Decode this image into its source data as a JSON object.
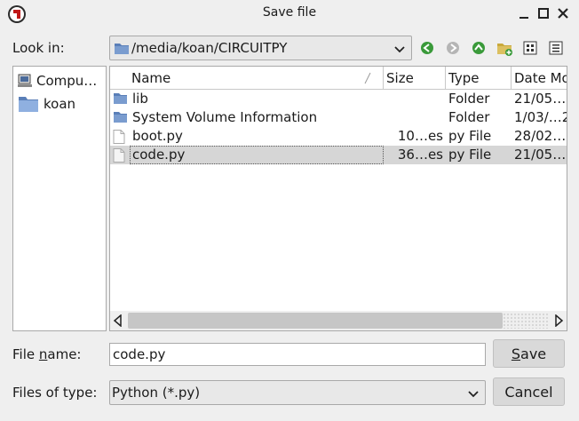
{
  "window": {
    "title": "Save file",
    "icons": {
      "app": "app-logo-icon",
      "minimize": "minimize-icon",
      "maximize": "maximize-icon",
      "close": "close-icon"
    }
  },
  "look_in": {
    "label": "Look in:",
    "path": "/media/koan/CIRCUITPY"
  },
  "toolbar": {
    "icons": [
      "back-icon",
      "forward-icon",
      "parent-dir-icon",
      "new-folder-icon",
      "list-view-icon",
      "detail-view-icon"
    ]
  },
  "sidebar": {
    "items": [
      {
        "label": "Compu…",
        "icon": "computer-icon"
      },
      {
        "label": "koan",
        "icon": "folder-icon"
      }
    ]
  },
  "file_list": {
    "columns": [
      "Name",
      "Size",
      "Type",
      "Date Mo"
    ],
    "rows": [
      {
        "name": "lib",
        "size": "",
        "type": "Folder",
        "date": "21/05…",
        "icon": "folder-icon"
      },
      {
        "name": "System Volume Information",
        "size": "",
        "type": "Folder",
        "date": "1/03/…2",
        "icon": "folder-icon"
      },
      {
        "name": "boot.py",
        "size": "10…es",
        "type": "py File",
        "date": "28/02…",
        "icon": "file-icon"
      },
      {
        "name": "code.py",
        "size": "36…es",
        "type": "py File",
        "date": "21/05…",
        "icon": "file-icon",
        "selected": true
      }
    ]
  },
  "file_name": {
    "label_pre": "File ",
    "label_mnemonic": "n",
    "label_post": "ame:",
    "value": "code.py"
  },
  "file_type": {
    "label": "Files of type:",
    "value": "Python (*.py)"
  },
  "buttons": {
    "save_mnemonic": "S",
    "save_rest": "ave",
    "cancel": "Cancel"
  },
  "colors": {
    "background": "#efefef",
    "selection": "#d6d6d6",
    "nav_green": "#3a9a3a",
    "folder_blue": "#5a7fb8",
    "app_red": "#c01818"
  }
}
